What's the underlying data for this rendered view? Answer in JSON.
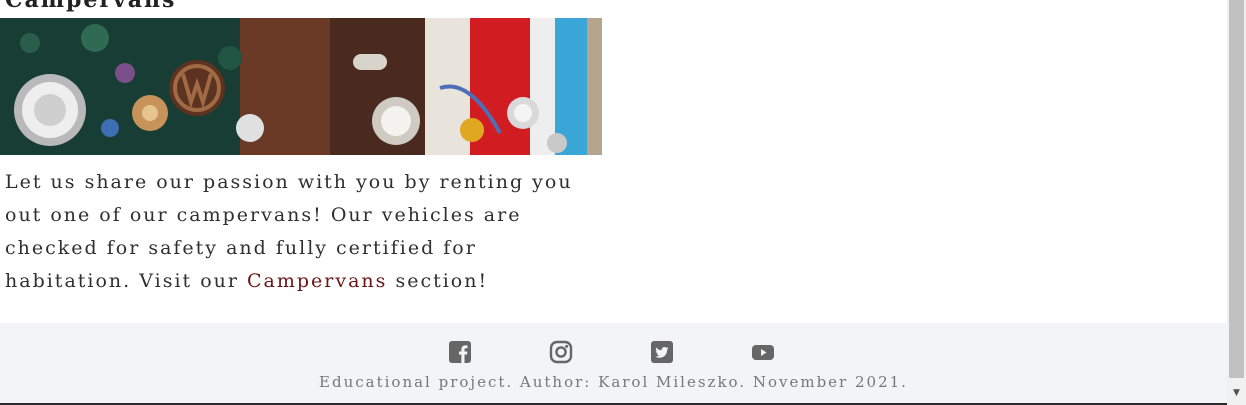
{
  "section": {
    "title": "Campervans"
  },
  "hero_image": {
    "alt": "Row of colourful vintage VW campervans"
  },
  "description": {
    "text_before": "Let us share our passion with you by renting you out one of our campervans! Our vehicles are checked for safety and fully certified for habitation. Visit our ",
    "link_label": "Campervans",
    "text_after": " section!",
    "link_color": "#6b1414"
  },
  "footer": {
    "icons": [
      "facebook-icon",
      "instagram-icon",
      "twitter-icon",
      "youtube-icon"
    ],
    "icon_color": "#666666",
    "copyright": "Educational project. Author: Karol Mileszko. November 2021."
  }
}
